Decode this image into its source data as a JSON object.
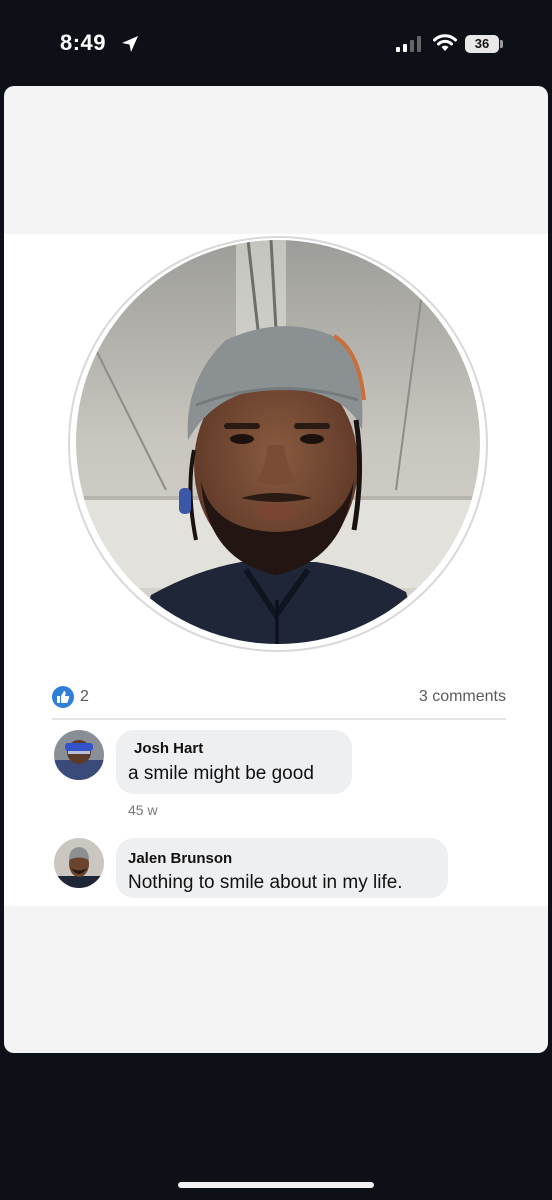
{
  "status_bar": {
    "time": "8:49",
    "battery": "36",
    "icons": [
      "location-arrow-icon",
      "cellular-signal-icon",
      "wifi-icon",
      "battery-icon"
    ]
  },
  "post": {
    "reactions": {
      "icon": "like-icon",
      "count": "2"
    },
    "comments_count": "3 comments"
  },
  "comments": [
    {
      "author": "Josh Hart",
      "text": "a smile might be good",
      "time": "45 w"
    },
    {
      "author": "Jalen Brunson",
      "text": "Nothing to smile about in my life."
    }
  ],
  "colors": {
    "like": "#2f7fd6",
    "bubble": "#eeeff1",
    "page_bg": "#0d1117"
  }
}
